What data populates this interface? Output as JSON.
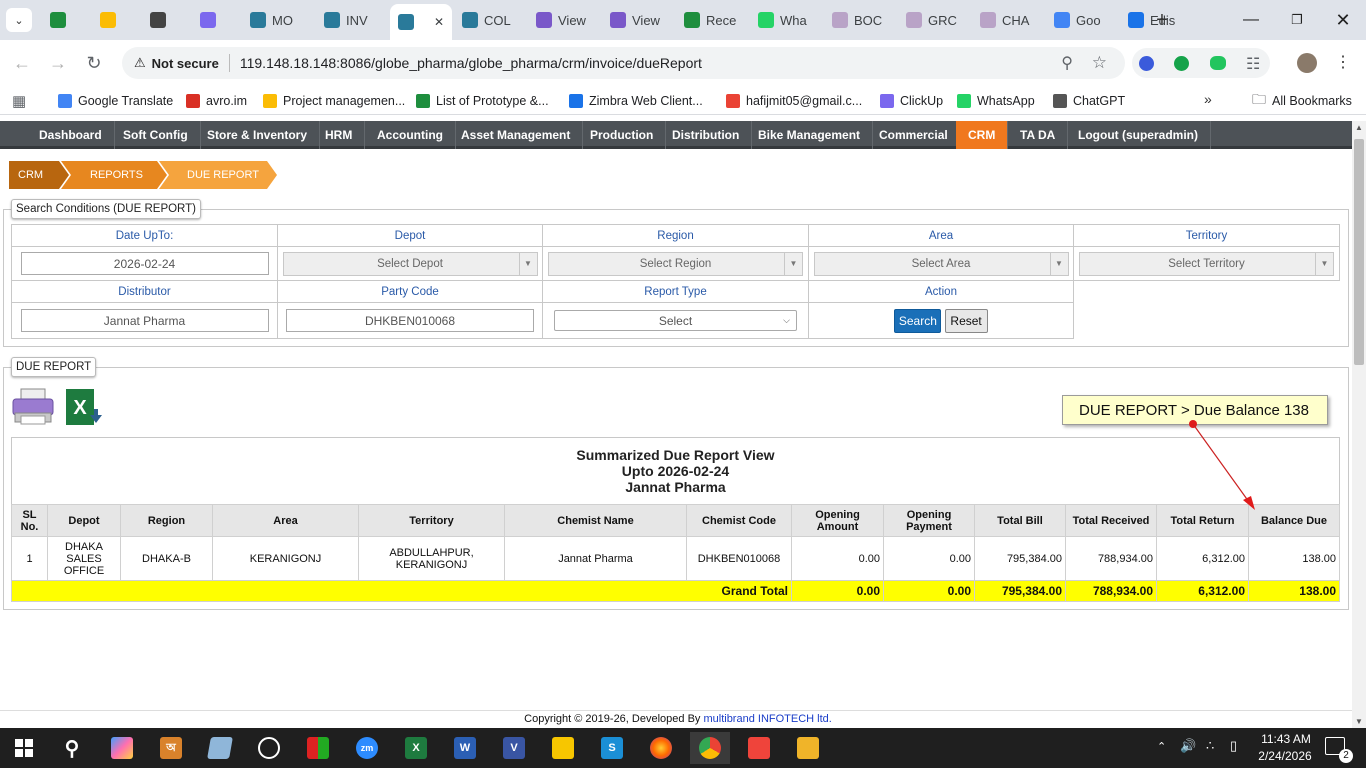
{
  "browser": {
    "tabs": [
      {
        "label": "",
        "icon": "sheets-icon"
      },
      {
        "label": "",
        "icon": "drive-icon"
      },
      {
        "label": "",
        "icon": "chatgpt-icon"
      },
      {
        "label": "",
        "icon": "clickup-icon"
      },
      {
        "label": "MO",
        "icon": "app-icon"
      },
      {
        "label": "INV",
        "icon": "app-icon"
      },
      {
        "label": "",
        "icon": "app-icon",
        "active": true
      },
      {
        "label": "COL",
        "icon": "app-icon"
      },
      {
        "label": "View",
        "icon": "view-icon"
      },
      {
        "label": "View",
        "icon": "view-icon"
      },
      {
        "label": "Rece",
        "icon": "sheets-icon"
      },
      {
        "label": "Wha",
        "icon": "whatsapp-icon"
      },
      {
        "label": "BOC",
        "icon": "gear-icon"
      },
      {
        "label": "GRC",
        "icon": "gear-icon"
      },
      {
        "label": "CHA",
        "icon": "gear-icon"
      },
      {
        "label": "Goo",
        "icon": "google-icon"
      },
      {
        "label": "Edis",
        "icon": "settings-icon"
      }
    ],
    "security_label": "Not secure",
    "url": "119.148.18.148:8086/globe_pharma/globe_pharma/crm/invoice/dueReport",
    "bookmarks": [
      "Google Translate",
      "avro.im",
      "Project managemen...",
      "List of Prototype &...",
      "Zimbra Web Client...",
      "hafijmit05@gmail.c...",
      "ClickUp",
      "WhatsApp",
      "ChatGPT"
    ],
    "all_bookmarks": "All Bookmarks"
  },
  "nav": {
    "items": [
      "Dashboard",
      "Soft Config",
      "Store & Inventory",
      "HRM",
      "Accounting",
      "Asset Management",
      "Production",
      "Distribution",
      "Bike Management",
      "Commercial",
      "CRM",
      "TA DA",
      "Logout (superadmin)"
    ],
    "active": "CRM"
  },
  "breadcrumb": [
    "CRM",
    "REPORTS",
    "DUE REPORT"
  ],
  "search": {
    "legend": "Search Conditions (DUE REPORT)",
    "labels": {
      "date": "Date UpTo:",
      "depot": "Depot",
      "region": "Region",
      "area": "Area",
      "territory": "Territory",
      "distributor": "Distributor",
      "party_code": "Party Code",
      "report_type": "Report Type",
      "action": "Action"
    },
    "values": {
      "date": "2026-02-24",
      "distributor": "Jannat Pharma",
      "party_code": "DHKBEN010068",
      "report_type": "Select"
    },
    "placeholders": {
      "depot": "Select Depot",
      "region": "Select Region",
      "area": "Select Area",
      "territory": "Select Territory"
    },
    "search_button": "Search",
    "reset_button": "Reset"
  },
  "report": {
    "legend": "DUE REPORT",
    "title": "Summarized Due Report View",
    "upto": "Upto 2026-02-24",
    "party": "Jannat Pharma",
    "columns": [
      "SL No.",
      "Depot",
      "Region",
      "Area",
      "Territory",
      "Chemist Name",
      "Chemist Code",
      "Opening Amount",
      "Opening Payment",
      "Total Bill",
      "Total Received",
      "Total Return",
      "Balance Due"
    ],
    "rows": [
      [
        "1",
        "DHAKA SALES OFFICE",
        "DHAKA-B",
        "KERANIGONJ",
        "ABDULLAHPUR, KERANIGONJ",
        "Jannat Pharma",
        "DHKBEN010068",
        "0.00",
        "0.00",
        "795,384.00",
        "788,934.00",
        "6,312.00",
        "138.00"
      ]
    ],
    "total_label": "Grand Total",
    "totals": [
      "0.00",
      "0.00",
      "795,384.00",
      "788,934.00",
      "6,312.00",
      "138.00"
    ]
  },
  "annotation": "DUE REPORT > Due Balance 138",
  "footer": {
    "text": "Copyright © 2019-26, Developed By ",
    "link": "multibrand INFOTECH ltd."
  },
  "taskbar": {
    "time": "11:43 AM",
    "date": "2/24/2026",
    "notifications": "2"
  }
}
